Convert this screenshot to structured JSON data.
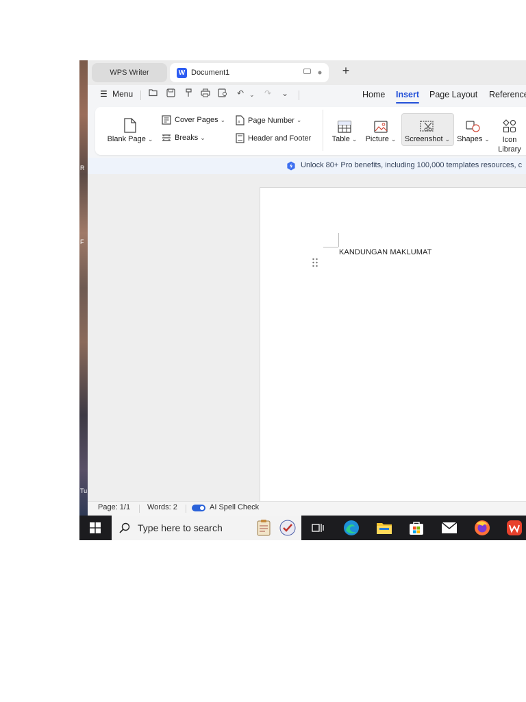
{
  "tabs": {
    "app_tab": "WPS Writer",
    "doc_tab": "Document1",
    "doc_logo": "W",
    "new_tab": "+"
  },
  "menu": {
    "menu_label": "Menu",
    "nav_tabs": [
      "Home",
      "Insert",
      "Page Layout",
      "Reference"
    ],
    "active_tab": "Insert"
  },
  "ribbon": {
    "blank_page": "Blank Page",
    "cover_pages": "Cover Pages",
    "breaks": "Breaks",
    "page_number": "Page Number",
    "header_footer": "Header and Footer",
    "table": "Table",
    "picture": "Picture",
    "screenshot": "Screenshot",
    "shapes": "Shapes",
    "icon_library_1": "Icon",
    "icon_library_2": "Library"
  },
  "banner": {
    "text": "Unlock 80+ Pro benefits, including 100,000 templates resources, c"
  },
  "document": {
    "content": "KANDUNGAN MAKLUMAT"
  },
  "status": {
    "page": "Page: 1/1",
    "words": "Words: 2",
    "spell": "AI Spell Check",
    "spell_on": true
  },
  "taskbar": {
    "search_placeholder": "Type here to search",
    "icons": [
      "windows-start-icon",
      "search-icon",
      "notes-app-icon",
      "checklist-app-icon",
      "task-view-icon",
      "edge-icon",
      "file-explorer-icon",
      "microsoft-store-icon",
      "mail-icon",
      "firefox-icon",
      "wps-office-icon"
    ]
  },
  "desktop": {
    "marks": [
      "R",
      "F",
      "Tu"
    ]
  },
  "colors": {
    "accent": "#2350d8",
    "wps_logo": "#2d5cf2",
    "taskbar": "#1c1c1f",
    "banner": "#eef3fb"
  }
}
